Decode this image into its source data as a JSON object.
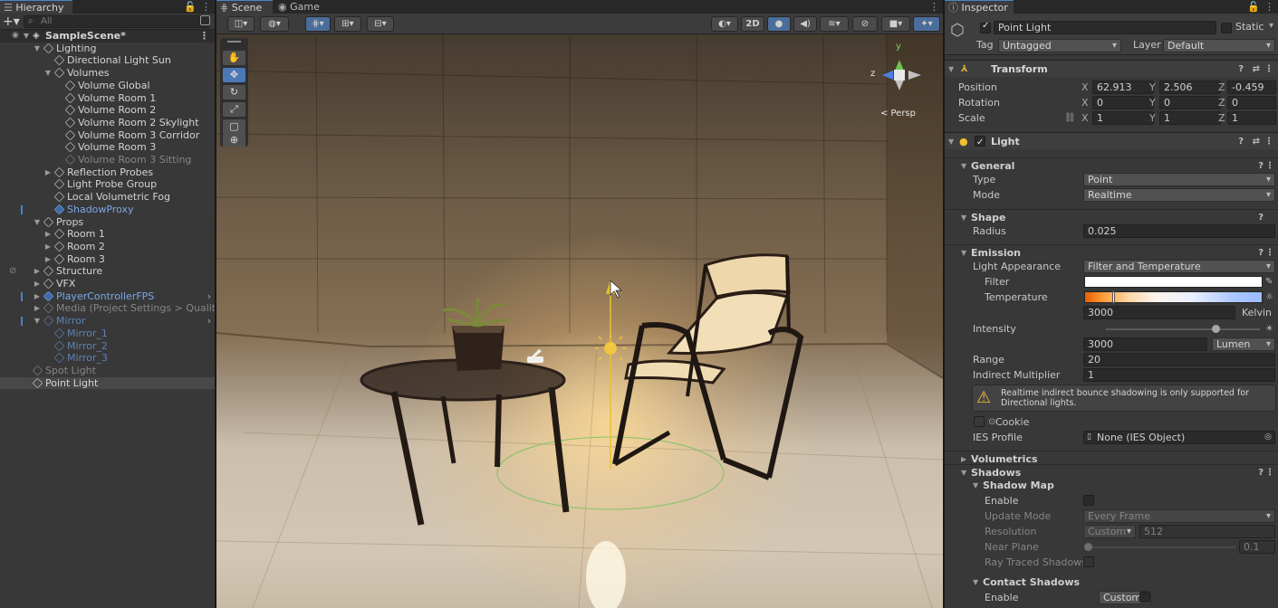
{
  "hierarchy": {
    "tab": "Hierarchy",
    "search_placeholder": "All",
    "scene_name": "SampleScene*",
    "items": {
      "lighting": "Lighting",
      "dir_light": "Directional Light Sun",
      "volumes": "Volumes",
      "vol_global": "Volume Global",
      "vol_r1": "Volume Room 1",
      "vol_r2": "Volume Room 2",
      "vol_r2sky": "Volume Room 2 Skylight",
      "vol_r3corr": "Volume Room 3 Corridor",
      "vol_r3": "Volume Room 3",
      "vol_r3sit": "Volume Room 3 Sitting",
      "refl": "Reflection Probes",
      "lpg": "Light Probe Group",
      "fog": "Local Volumetric Fog",
      "shadowproxy": "ShadowProxy",
      "props": "Props",
      "room1": "Room 1",
      "room2": "Room 2",
      "room3": "Room 3",
      "structure": "Structure",
      "vfx": "VFX",
      "player": "PlayerControllerFPS",
      "media": "Media (Project Settings > Quality",
      "mirror": "Mirror",
      "mirror1": "Mirror_1",
      "mirror2": "Mirror_2",
      "mirror3": "Mirror_3",
      "spot": "Spot Light",
      "point": "Point Light"
    }
  },
  "scene": {
    "tab_scene": "Scene",
    "tab_game": "Game",
    "btn_2d": "2D",
    "persp": "< Persp",
    "gizmo_y": "y",
    "gizmo_z": "z"
  },
  "inspector": {
    "tab": "Inspector",
    "object_name": "Point Light",
    "static_label": "Static",
    "tag_label": "Tag",
    "tag_value": "Untagged",
    "layer_label": "Layer",
    "layer_value": "Default",
    "transform": {
      "title": "Transform",
      "position_label": "Position",
      "rotation_label": "Rotation",
      "scale_label": "Scale",
      "x": "X",
      "y": "Y",
      "z": "Z",
      "pos": [
        "62.913",
        "2.506",
        "-0.459"
      ],
      "rot": [
        "0",
        "0",
        "0"
      ],
      "scl": [
        "1",
        "1",
        "1"
      ]
    },
    "light": {
      "title": "Light",
      "general": "General",
      "type_label": "Type",
      "type_value": "Point",
      "mode_label": "Mode",
      "mode_value": "Realtime",
      "shape": "Shape",
      "radius_label": "Radius",
      "radius_value": "0.025",
      "emission": "Emission",
      "appearance_label": "Light Appearance",
      "appearance_value": "Filter and Temperature",
      "filter_label": "Filter",
      "temperature_label": "Temperature",
      "temperature_value": "3000",
      "kelvin": "Kelvin",
      "intensity_label": "Intensity",
      "intensity_value": "3000",
      "intensity_unit": "Lumen",
      "range_label": "Range",
      "range_value": "20",
      "indirect_label": "Indirect Multiplier",
      "indirect_value": "1",
      "warning": "Realtime indirect bounce shadowing is only supported for Directional lights.",
      "cookie_label": "Cookie",
      "ies_label": "IES Profile",
      "ies_value": "None (IES Object)",
      "volumetrics": "Volumetrics",
      "shadows": "Shadows",
      "shadow_map": "Shadow Map",
      "enable_label": "Enable",
      "update_mode_label": "Update Mode",
      "update_mode_value": "Every Frame",
      "resolution_label": "Resolution",
      "resolution_dd": "Custom",
      "resolution_value": "512",
      "near_plane_label": "Near Plane",
      "near_plane_value": "0.1",
      "ray_traced_label": "Ray Traced Shadows",
      "contact_shadows": "Contact Shadows",
      "contact_enable_label": "Enable",
      "contact_enable_value": "Custom"
    }
  }
}
